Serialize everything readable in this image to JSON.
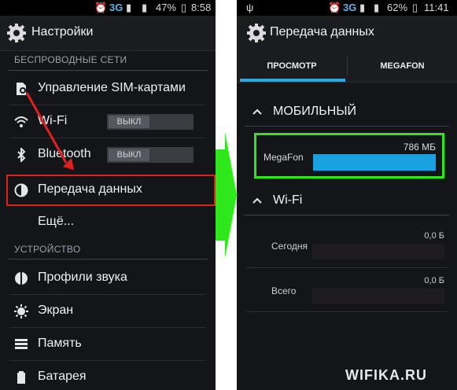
{
  "left": {
    "status": {
      "network": "3G",
      "battery": "47%",
      "time": "8:58"
    },
    "title": "Настройки",
    "section_wireless": "БЕСПРОВОДНЫЕ СЕТИ",
    "items": {
      "sim": "Управление SIM-картами",
      "wifi": "Wi-Fi",
      "wifi_toggle": "ВЫКЛ",
      "bluetooth": "Bluetooth",
      "bluetooth_toggle": "ВЫКЛ",
      "data": "Передача данных",
      "more": "Ещё..."
    },
    "section_device": "УСТРОЙСТВО",
    "device_items": {
      "sound": "Профили звука",
      "screen": "Экран",
      "memory": "Память",
      "battery": "Батарея"
    }
  },
  "right": {
    "status": {
      "network": "3G",
      "battery": "62%",
      "time": "11:41"
    },
    "title": "Передача данных",
    "tabs": [
      "ПРОСМОТР",
      "MEGAFON"
    ],
    "mobile_header": "МОБИЛЬНЫЙ",
    "megafon": {
      "label": "MegaFon",
      "value": "786 МБ"
    },
    "wifi_header": "Wi-Fi",
    "today": {
      "label": "Сегодня",
      "value": "0,0 Б"
    },
    "total": {
      "label": "Всего",
      "value": "0,0 Б"
    }
  },
  "watermark": "WIFIKA.RU",
  "colors": {
    "highlight_red": "#e02020",
    "highlight_green": "#2ee81c",
    "accent_blue": "#1aa2e0"
  }
}
